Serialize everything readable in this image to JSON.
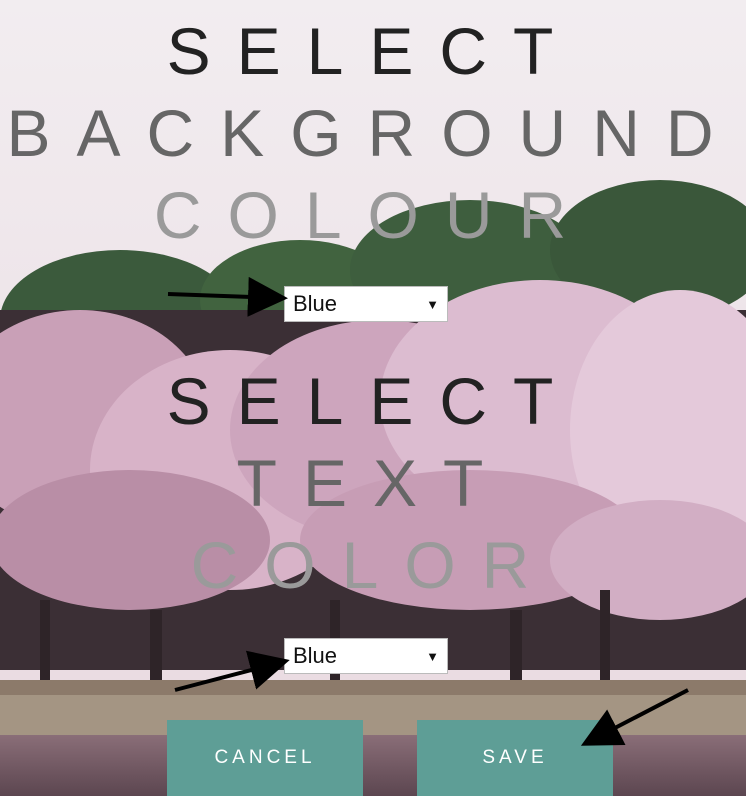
{
  "background_heading": {
    "line1": "SELECT",
    "line2": "BACKGROUND",
    "line3": "COLOUR"
  },
  "background_select": {
    "value": "Blue"
  },
  "text_heading": {
    "line1": "SELECT",
    "line2": "TEXT",
    "line3": "COLOR"
  },
  "text_select": {
    "value": "Blue"
  },
  "buttons": {
    "cancel": "CANCEL",
    "save": "SAVE"
  },
  "colors": {
    "button": "#5e9e96",
    "heading_dark": "#222222",
    "heading_mid": "#666666",
    "heading_light": "#9a9a9a"
  }
}
